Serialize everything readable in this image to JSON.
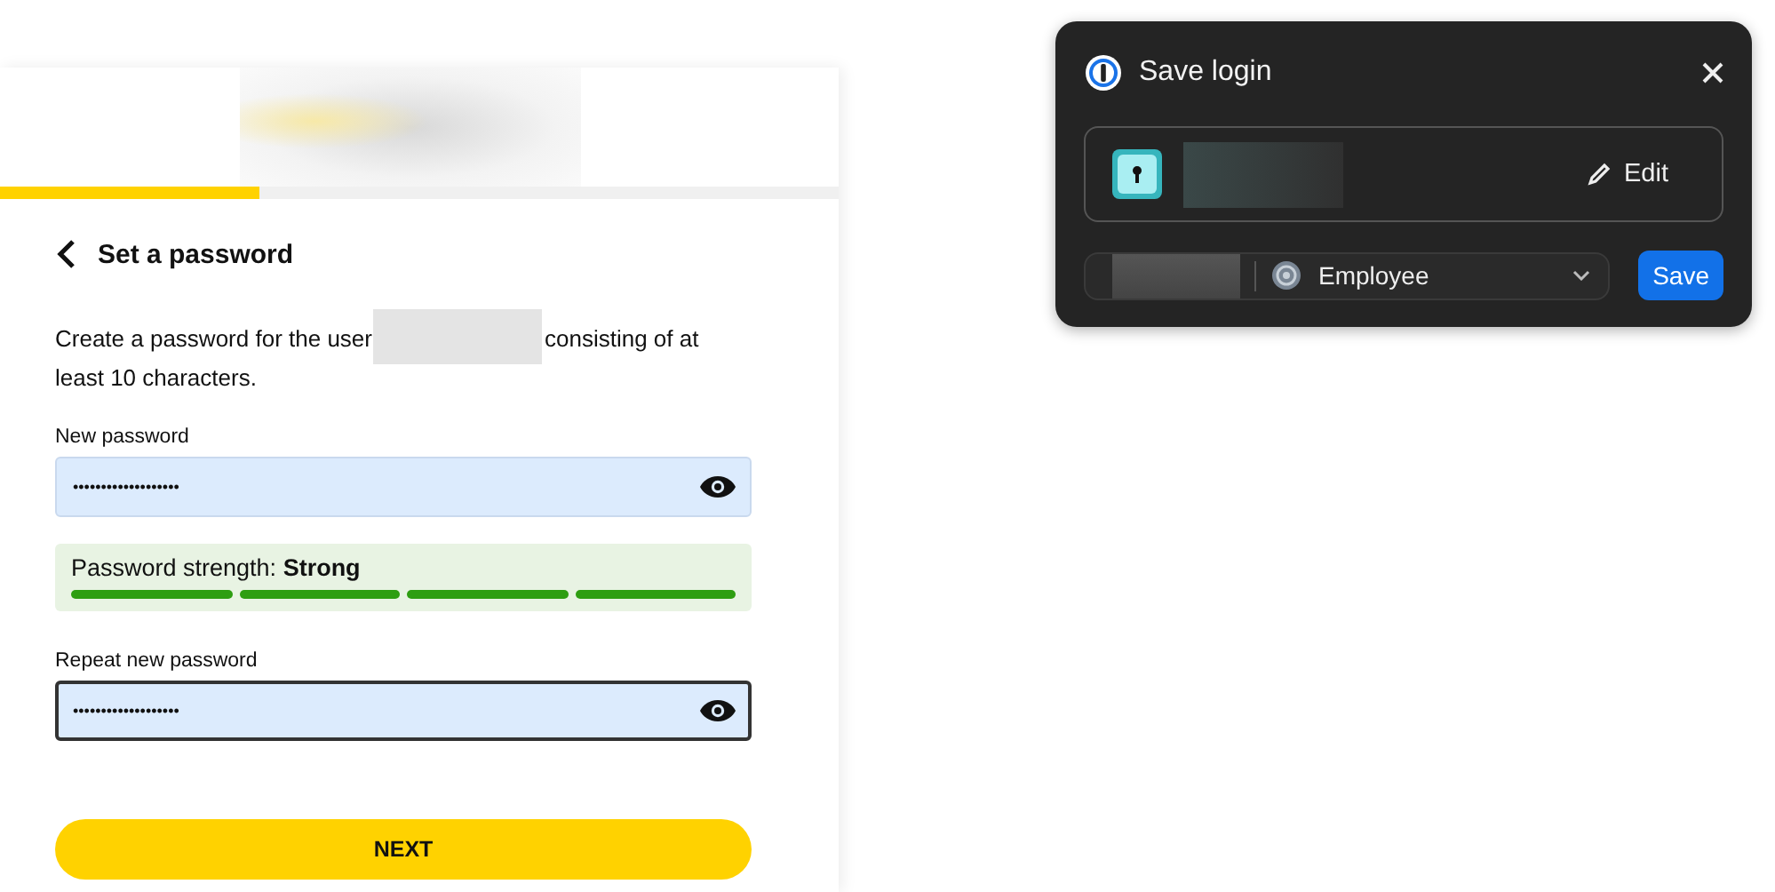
{
  "form": {
    "progress": {
      "level": 0.31
    },
    "title": "Set a password",
    "description_before": "Create a password for the user",
    "description_after": "consisting of at least 10 characters.",
    "fields": [
      {
        "label": "New password",
        "value": "•••••••••••••••••••",
        "focused": false
      },
      {
        "label": "Repeat new password",
        "value": "•••••••••••••••••••",
        "focused": true
      }
    ],
    "strength": {
      "label": "Password strength: **Strong**",
      "segments": [
        {
          "filled": true
        },
        {
          "filled": true
        },
        {
          "filled": true
        },
        {
          "filled": true
        }
      ]
    },
    "next_button": "NEXT"
  },
  "popup": {
    "title": "Save login",
    "edit_button": "Edit",
    "vault": "Employee",
    "save_button": "Save"
  }
}
